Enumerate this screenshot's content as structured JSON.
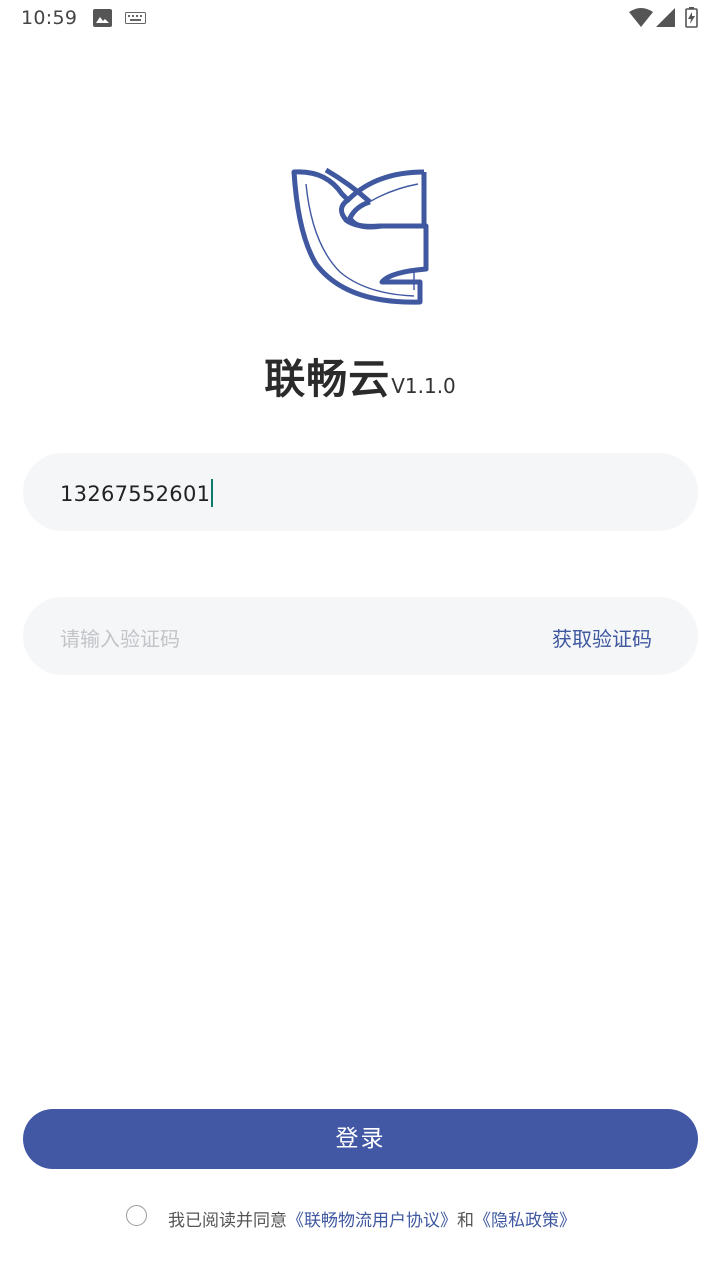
{
  "status_bar": {
    "time": "10:59",
    "icons": [
      "image-icon",
      "keyboard-icon",
      "wifi-icon",
      "signal-icon",
      "battery-charging-icon"
    ]
  },
  "logo": {
    "icon": "app-logo",
    "color": "#3f58a0"
  },
  "app": {
    "name": "联畅云",
    "version": "V1.1.0"
  },
  "phone_field": {
    "value": "13267552601"
  },
  "code_field": {
    "placeholder": "请输入验证码",
    "get_code_label": "获取验证码"
  },
  "login_button": {
    "label": "登录",
    "color": "#4258a4"
  },
  "agreement": {
    "checked": false,
    "prefix": "我已阅读并同意",
    "user_agreement": "《联畅物流用户协议》",
    "conjunction": "和",
    "privacy_policy": "《隐私政策》"
  },
  "colors": {
    "accent": "#3f58a0",
    "field_bg": "#f5f6f8",
    "placeholder": "#c2c4c8"
  }
}
